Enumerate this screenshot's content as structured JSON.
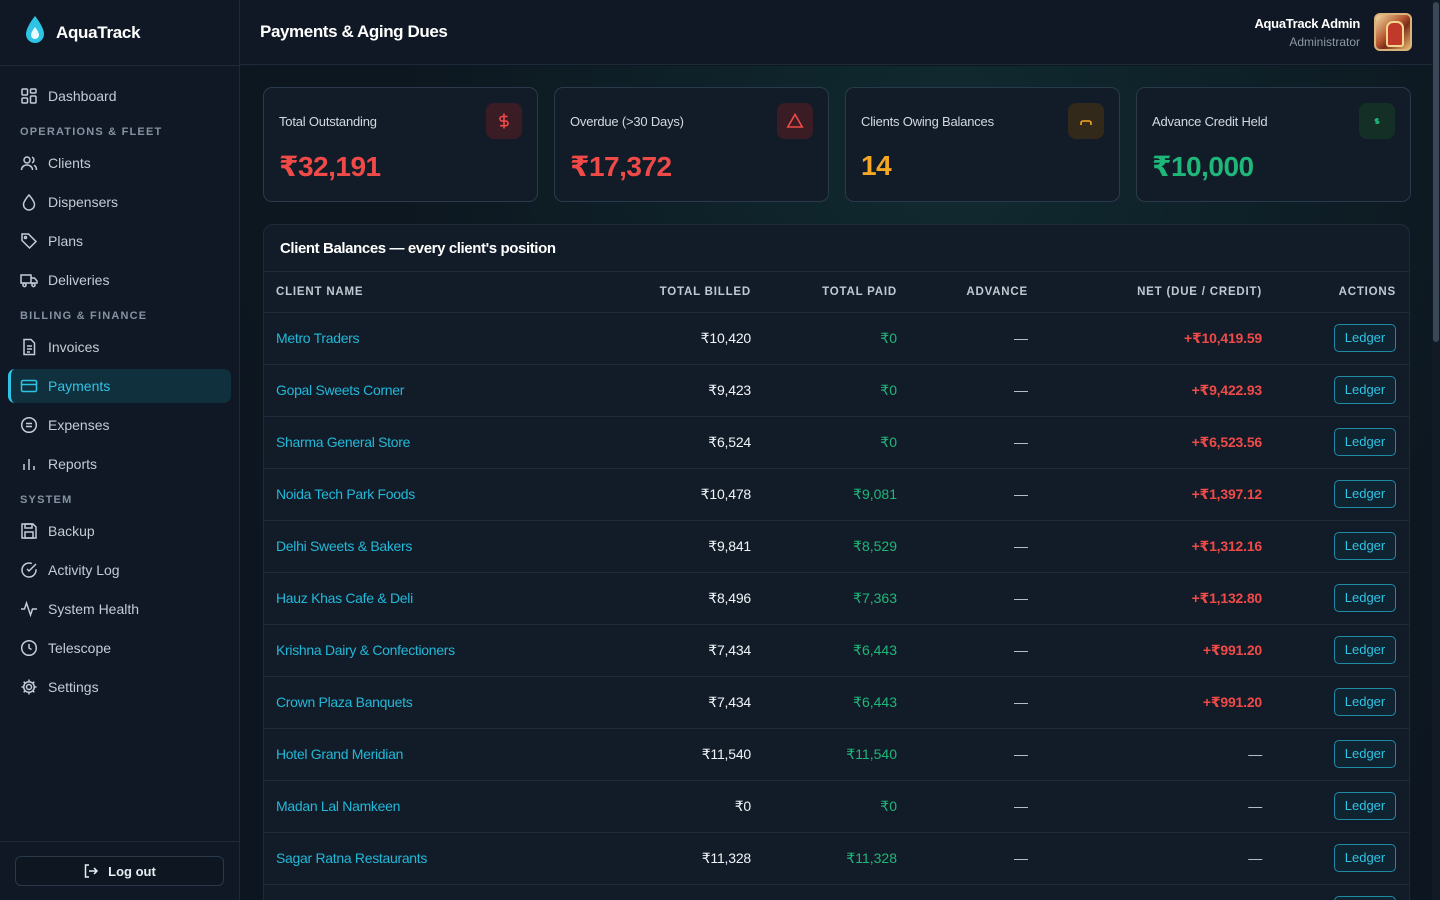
{
  "app": {
    "name": "AquaTrack"
  },
  "header": {
    "title": "Payments & Aging Dues",
    "user_name": "AquaTrack Admin",
    "user_role": "Administrator"
  },
  "sidebar": {
    "dashboard": "Dashboard",
    "sections": [
      {
        "title": "OPERATIONS & FLEET",
        "items": [
          "Clients",
          "Dispensers",
          "Plans",
          "Deliveries"
        ]
      },
      {
        "title": "BILLING & FINANCE",
        "items": [
          "Invoices",
          "Payments",
          "Expenses",
          "Reports"
        ]
      },
      {
        "title": "SYSTEM",
        "items": [
          "Backup",
          "Activity Log",
          "System Health",
          "Telescope",
          "Settings"
        ]
      }
    ],
    "active": "Payments",
    "logout": "Log out"
  },
  "cards": [
    {
      "label": "Total Outstanding",
      "value": "₹32,191",
      "color": "#f04a48",
      "icon": "dollar-icon"
    },
    {
      "label": "Overdue (>30 Days)",
      "value": "₹17,372",
      "color": "#f04a48",
      "icon": "warning-triangle-icon"
    },
    {
      "label": "Clients Owing Balances",
      "value": "14",
      "color": "#f5a623",
      "icon": "users-icon"
    },
    {
      "label": "Advance Credit Held",
      "value": "₹10,000",
      "color": "#1fb67a",
      "icon": "dollar-icon"
    }
  ],
  "table": {
    "title": "Client Balances — every client's position",
    "columns": [
      "CLIENT NAME",
      "TOTAL BILLED",
      "TOTAL PAID",
      "ADVANCE",
      "NET (DUE / CREDIT)",
      "ACTIONS"
    ],
    "action_label": "Ledger",
    "rows": [
      {
        "name": "Metro Traders",
        "billed": "₹10,420",
        "paid": "₹0",
        "advance": "—",
        "net": "+₹10,419.59"
      },
      {
        "name": "Gopal Sweets Corner",
        "billed": "₹9,423",
        "paid": "₹0",
        "advance": "—",
        "net": "+₹9,422.93"
      },
      {
        "name": "Sharma General Store",
        "billed": "₹6,524",
        "paid": "₹0",
        "advance": "—",
        "net": "+₹6,523.56"
      },
      {
        "name": "Noida Tech Park Foods",
        "billed": "₹10,478",
        "paid": "₹9,081",
        "advance": "—",
        "net": "+₹1,397.12"
      },
      {
        "name": "Delhi Sweets & Bakers",
        "billed": "₹9,841",
        "paid": "₹8,529",
        "advance": "—",
        "net": "+₹1,312.16"
      },
      {
        "name": "Hauz Khas Cafe & Deli",
        "billed": "₹8,496",
        "paid": "₹7,363",
        "advance": "—",
        "net": "+₹1,132.80"
      },
      {
        "name": "Krishna Dairy & Confectioners",
        "billed": "₹7,434",
        "paid": "₹6,443",
        "advance": "—",
        "net": "+₹991.20"
      },
      {
        "name": "Crown Plaza Banquets",
        "billed": "₹7,434",
        "paid": "₹6,443",
        "advance": "—",
        "net": "+₹991.20"
      },
      {
        "name": "Hotel Grand Meridian",
        "billed": "₹11,540",
        "paid": "₹11,540",
        "advance": "—",
        "net": "—"
      },
      {
        "name": "Madan Lal Namkeen",
        "billed": "₹0",
        "paid": "₹0",
        "advance": "—",
        "net": "—"
      },
      {
        "name": "Sagar Ratna Restaurants",
        "billed": "₹11,328",
        "paid": "₹11,328",
        "advance": "—",
        "net": "—"
      },
      {
        "name": "",
        "billed": "",
        "paid": "",
        "advance": "",
        "net": ""
      }
    ]
  },
  "colors": {
    "accent": "#2ec4e6",
    "due": "#f04a48",
    "paid": "#1fb67a",
    "warning": "#f5a623"
  }
}
